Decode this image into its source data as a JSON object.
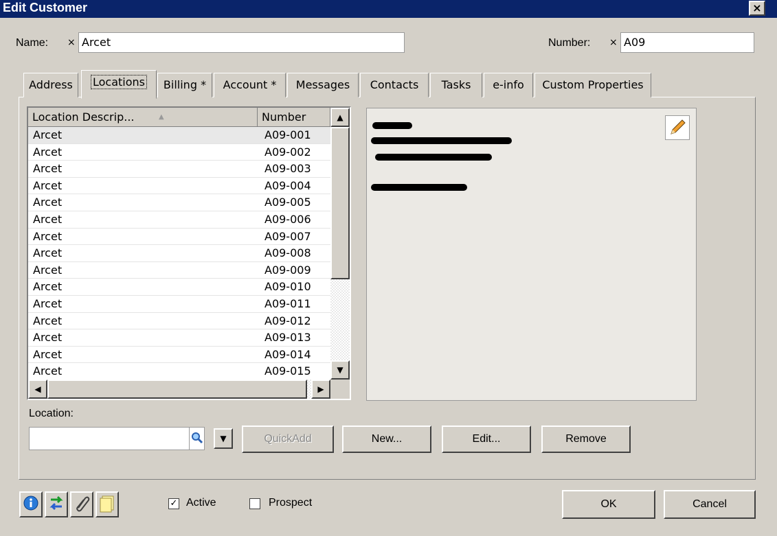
{
  "window": {
    "title": "Edit Customer",
    "close": "×"
  },
  "name": {
    "label": "Name:",
    "required_mark": "×",
    "value": "Arcet"
  },
  "number": {
    "label": "Number:",
    "required_mark": "×",
    "value": "A09"
  },
  "tabs": [
    {
      "label": "Address"
    },
    {
      "label": "Locations",
      "selected": true
    },
    {
      "label": "Billing *"
    },
    {
      "label": "Account *"
    },
    {
      "label": "Messages"
    },
    {
      "label": "Contacts"
    },
    {
      "label": "Tasks"
    },
    {
      "label": "e-info"
    },
    {
      "label": "Custom Properties"
    }
  ],
  "list": {
    "columns": [
      "Location Descrip...",
      "Number"
    ],
    "sort_indicator": "▲",
    "rows": [
      [
        "Arcet",
        "A09-001"
      ],
      [
        "Arcet",
        "A09-002"
      ],
      [
        "Arcet",
        "A09-003"
      ],
      [
        "Arcet",
        "A09-004"
      ],
      [
        "Arcet",
        "A09-005"
      ],
      [
        "Arcet",
        "A09-006"
      ],
      [
        "Arcet",
        "A09-007"
      ],
      [
        "Arcet",
        "A09-008"
      ],
      [
        "Arcet",
        "A09-009"
      ],
      [
        "Arcet",
        "A09-010"
      ],
      [
        "Arcet",
        "A09-011"
      ],
      [
        "Arcet",
        "A09-012"
      ],
      [
        "Arcet",
        "A09-013"
      ],
      [
        "Arcet",
        "A09-014"
      ],
      [
        "Arcet",
        "A09-015"
      ]
    ],
    "selected_index": 0
  },
  "location": {
    "label": "Location:",
    "value": ""
  },
  "buttons": {
    "quickadd": "QuickAdd",
    "new": "New...",
    "edit": "Edit...",
    "remove": "Remove",
    "ok": "OK",
    "cancel": "Cancel"
  },
  "checks": {
    "active": "Active",
    "active_checked": true,
    "prospect": "Prospect",
    "prospect_checked": false
  },
  "icons": [
    "info-icon",
    "swap-arrows-icon",
    "paperclip-icon",
    "notes-icon",
    "pencil-icon",
    "magnifier-icon"
  ]
}
